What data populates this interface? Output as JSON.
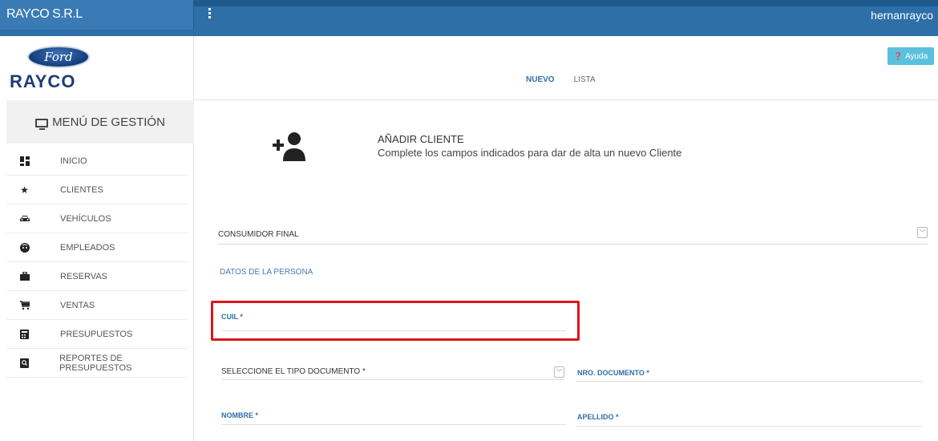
{
  "topbar": {
    "brand": "RAYCO S.R.L",
    "username": "hernanrayco"
  },
  "sidebar": {
    "logo": {
      "ford": "Ford",
      "name": "RAYCO"
    },
    "menu_title": "MENÚ DE GESTIÓN",
    "items": [
      {
        "label": "INICIO",
        "icon": "dashboard-icon"
      },
      {
        "label": "CLIENTES",
        "icon": "star-icon"
      },
      {
        "label": "VEHÍCULOS",
        "icon": "car-icon"
      },
      {
        "label": "EMPLEADOS",
        "icon": "face-icon"
      },
      {
        "label": "RESERVAS",
        "icon": "briefcase-icon"
      },
      {
        "label": "VENTAS",
        "icon": "cart-icon"
      },
      {
        "label": "PRESUPUESTOS",
        "icon": "calculator-icon"
      },
      {
        "label": "REPORTES DE PRESUPUESTOS",
        "icon": "report-search-icon"
      }
    ]
  },
  "header": {
    "help_label": "Ayuda"
  },
  "tabs": [
    {
      "label": "NUEVO",
      "active": true
    },
    {
      "label": "LISTA",
      "active": false
    }
  ],
  "form": {
    "title": "AÑADIR CLIENTE",
    "subtitle": "Complete los campos indicados para dar de alta un nuevo Cliente",
    "tipo_cliente": "CONSUMIDOR FINAL",
    "section_label": "DATOS DE LA PERSONA",
    "cuil_label": "CUIL *",
    "tipo_documento": "SELECCIONE EL TIPO DOCUMENTO *",
    "nro_documento_label": "NRO. DOCUMENTO *",
    "nombre_label": "NOMBRE *",
    "apellido_label": "APELLIDO *"
  },
  "colors": {
    "primary": "#2e6fa8",
    "help": "#5bc0de",
    "highlight": "#d9171c",
    "logo_blue": "#1e3d74"
  }
}
